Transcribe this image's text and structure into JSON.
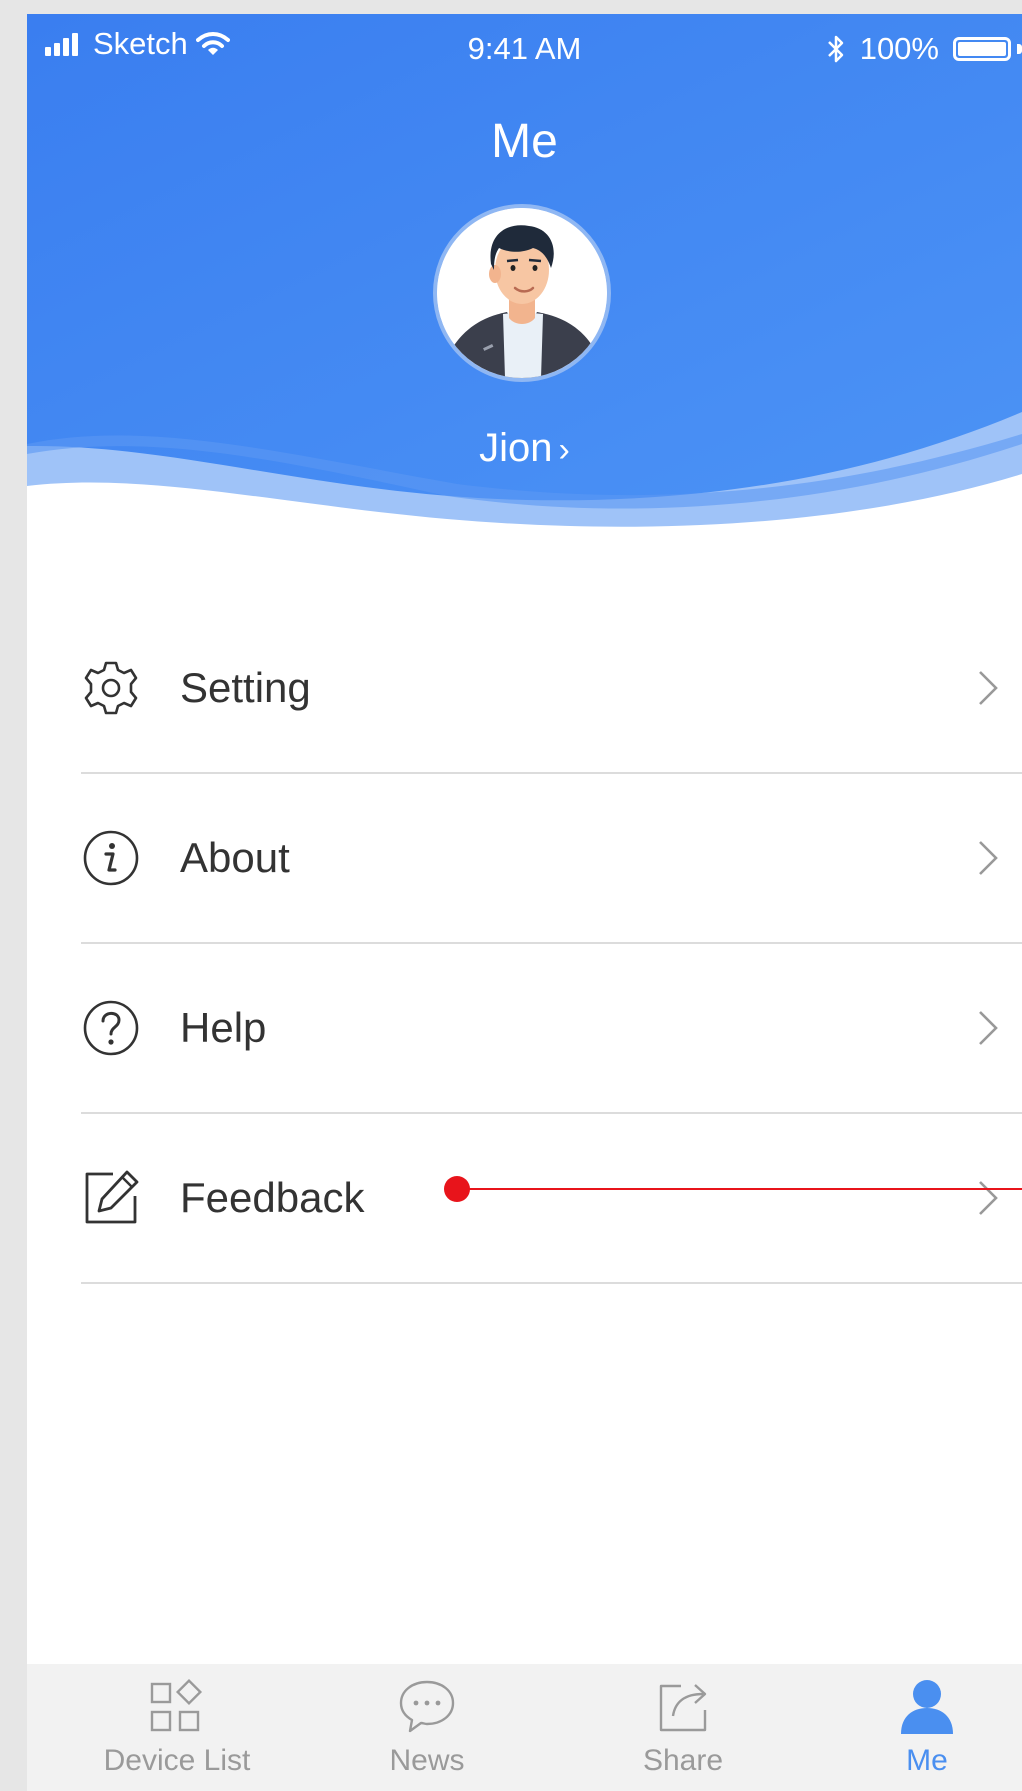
{
  "status_bar": {
    "carrier": "Sketch",
    "time": "9:41 AM",
    "battery": "100%"
  },
  "header": {
    "title": "Me",
    "profile_name": "Jion",
    "name_chevron": "›"
  },
  "menu": {
    "items": [
      {
        "label": "Setting",
        "icon": "gear-icon"
      },
      {
        "label": "About",
        "icon": "info-icon"
      },
      {
        "label": "Help",
        "icon": "help-icon"
      },
      {
        "label": "Feedback",
        "icon": "edit-icon"
      }
    ]
  },
  "tabbar": {
    "tabs": [
      {
        "label": "Device List",
        "icon": "device-grid-icon",
        "active": false
      },
      {
        "label": "News",
        "icon": "chat-bubble-icon",
        "active": false
      },
      {
        "label": "Share",
        "icon": "share-icon",
        "active": false
      },
      {
        "label": "Me",
        "icon": "person-icon",
        "active": true
      }
    ]
  },
  "colors": {
    "header_blue": "#3a7ef0",
    "active_tab": "#4a8ff0",
    "annotation_red": "#e8141b"
  }
}
